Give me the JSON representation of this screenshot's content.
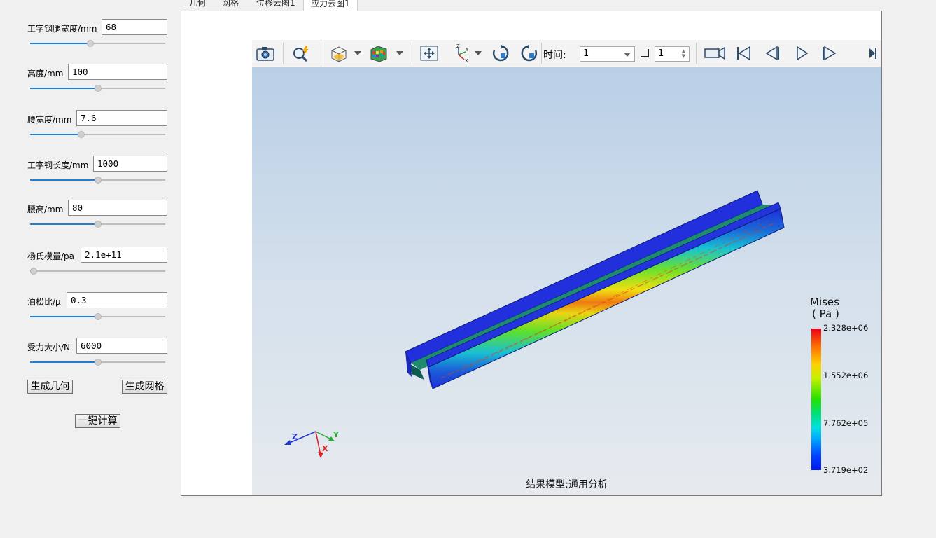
{
  "tabs": [
    "几何",
    "网格",
    "位移云图1",
    "应力云图1"
  ],
  "params": [
    {
      "label": "工字钢腿宽度/mm",
      "value": "68",
      "level": 0.44
    },
    {
      "label": "高度/mm",
      "value": "100",
      "level": 0.5
    },
    {
      "label": "腰宽度/mm",
      "value": "7.6",
      "level": 0.37
    },
    {
      "label": "工字钢长度/mm",
      "value": "1000",
      "level": 0.5
    },
    {
      "label": "腰高/mm",
      "value": "80",
      "level": 0.5
    },
    {
      "label": "杨氏模量/pa",
      "value": "2.1e+11",
      "level": 0.0
    },
    {
      "label": "泊松比/μ",
      "value": "0.3",
      "level": 0.5
    },
    {
      "label": "受力大小/N",
      "value": "6000",
      "level": 0.5
    }
  ],
  "buttons": {
    "gen_geometry": "生成几何",
    "gen_mesh": "生成网格",
    "compute": "一键计算"
  },
  "toolbar": {
    "time_label": "时间:",
    "time_value": "1",
    "step_value": "1"
  },
  "icons": [
    "camera-icon",
    "zoom-lightning-icon",
    "view-cube-icon",
    "color-cube-icon",
    "fit-view-icon",
    "axes-icon",
    "rotate-cw-icon",
    "rotate-ccw-icon",
    "record-camera-icon",
    "first-frame-icon",
    "prev-frame-icon",
    "play-icon",
    "next-frame-icon",
    "last-frame-icon"
  ],
  "legend": {
    "title_line1": "Mises",
    "title_line2": "( Pa )",
    "ticks": [
      "2.328e+06",
      "1.552e+06",
      "7.762e+05",
      "3.719e+02"
    ]
  },
  "triad": {
    "z": "Z",
    "y": "Y",
    "x": "X"
  },
  "footer": "结果模型:通用分析",
  "colors": {
    "accent": "#1e7fd6",
    "beam_blue": "#1f2fd8",
    "beam_web": "#1e8a6e"
  }
}
